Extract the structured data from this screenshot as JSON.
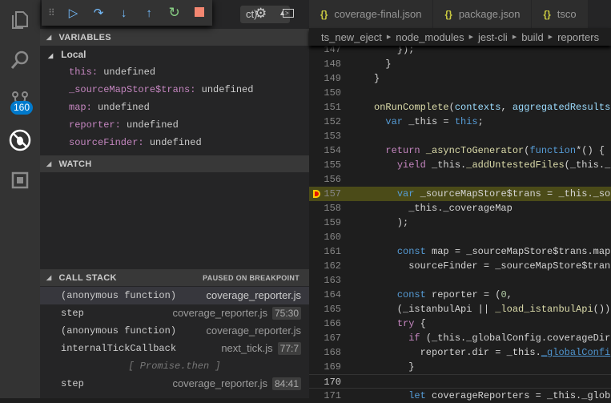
{
  "activity": {
    "scm_badge": "160"
  },
  "topbar": {
    "config_value": "ct)"
  },
  "variables": {
    "title": "VARIABLES",
    "scope": "Local",
    "items": [
      {
        "name": "this",
        "value": "undefined"
      },
      {
        "name": "_sourceMapStore$trans",
        "value": "undefined"
      },
      {
        "name": "map",
        "value": "undefined"
      },
      {
        "name": "reporter",
        "value": "undefined"
      },
      {
        "name": "sourceFinder",
        "value": "undefined"
      }
    ]
  },
  "watch": {
    "title": "WATCH"
  },
  "callstack": {
    "title": "CALL STACK",
    "status": "PAUSED ON BREAKPOINT",
    "frames": [
      {
        "fn": "(anonymous function)",
        "file": "coverage_reporter.js",
        "pos": ""
      },
      {
        "fn": "step",
        "file": "coverage_reporter.js",
        "pos": "75:30"
      },
      {
        "fn": "(anonymous function)",
        "file": "coverage_reporter.js",
        "pos": ""
      },
      {
        "fn": "internalTickCallback",
        "file": "next_tick.js",
        "pos": "77:7"
      },
      {
        "fn": "[ Promise.then ]",
        "file": "",
        "pos": ""
      },
      {
        "fn": "step",
        "file": "coverage_reporter.js",
        "pos": "84:41"
      }
    ]
  },
  "tabs": [
    {
      "label": "coverage-final.json"
    },
    {
      "label": "package.json"
    },
    {
      "label": "tsco"
    }
  ],
  "breadcrumbs": [
    "ts_new_eject",
    "node_modules",
    "jest-cli",
    "build",
    "reporters"
  ],
  "code": [
    {
      "n": "147",
      "s": [
        [
          "    });",
          ""
        ]
      ]
    },
    {
      "n": "148",
      "s": [
        [
          "  }",
          ""
        ]
      ]
    },
    {
      "n": "149",
      "s": [
        [
          "}",
          ""
        ]
      ]
    },
    {
      "n": "150",
      "s": []
    },
    {
      "n": "151",
      "s": [
        [
          "onRunComplete",
          "f"
        ],
        [
          "(",
          ""
        ],
        [
          "contexts",
          "p"
        ],
        [
          ", ",
          ""
        ],
        [
          "aggregatedResults",
          "p"
        ]
      ]
    },
    {
      "n": "152",
      "s": [
        [
          "  ",
          ""
        ],
        [
          "var",
          "k"
        ],
        [
          " _this = ",
          ""
        ],
        [
          "this",
          "k"
        ],
        [
          ";",
          ""
        ]
      ]
    },
    {
      "n": "153",
      "s": []
    },
    {
      "n": "154",
      "s": [
        [
          "  ",
          ""
        ],
        [
          "return",
          "c"
        ],
        [
          " ",
          ""
        ],
        [
          "_asyncToGenerator",
          "f"
        ],
        [
          "(",
          ""
        ],
        [
          "function",
          "k"
        ],
        [
          "*() {",
          ""
        ]
      ]
    },
    {
      "n": "155",
      "s": [
        [
          "    ",
          ""
        ],
        [
          "yield",
          "c"
        ],
        [
          " _this.",
          ""
        ],
        [
          "_addUntestedFiles",
          "f"
        ],
        [
          "(_this._",
          ""
        ]
      ]
    },
    {
      "n": "156",
      "s": []
    },
    {
      "n": "157",
      "s": [
        [
          "    ",
          ""
        ],
        [
          "var",
          "k"
        ],
        [
          " _sourceMapStore$trans = _this._so",
          ""
        ]
      ]
    },
    {
      "n": "158",
      "s": [
        [
          "      _this._coverageMap",
          ""
        ]
      ]
    },
    {
      "n": "159",
      "s": [
        [
          "    );",
          ""
        ]
      ]
    },
    {
      "n": "160",
      "s": []
    },
    {
      "n": "161",
      "s": [
        [
          "    ",
          ""
        ],
        [
          "const",
          "k"
        ],
        [
          " map = _sourceMapStore$trans.map",
          ""
        ]
      ]
    },
    {
      "n": "162",
      "s": [
        [
          "      sourceFinder = _sourceMapStore$tran",
          ""
        ]
      ]
    },
    {
      "n": "163",
      "s": []
    },
    {
      "n": "164",
      "s": [
        [
          "    ",
          ""
        ],
        [
          "const",
          "k"
        ],
        [
          " reporter = (",
          ""
        ],
        [
          "0",
          "n"
        ],
        [
          ",",
          ""
        ]
      ]
    },
    {
      "n": "165",
      "s": [
        [
          "    (_istanbulApi || ",
          ""
        ],
        [
          "_load_istanbulApi",
          "f"
        ],
        [
          "())",
          ""
        ]
      ]
    },
    {
      "n": "166",
      "s": [
        [
          "    ",
          ""
        ],
        [
          "try",
          "c"
        ],
        [
          " {",
          ""
        ]
      ]
    },
    {
      "n": "167",
      "s": [
        [
          "      ",
          ""
        ],
        [
          "if",
          "c"
        ],
        [
          " (_this._globalConfig.coverageDir",
          ""
        ]
      ]
    },
    {
      "n": "168",
      "s": [
        [
          "        reporter.dir = _this.",
          ""
        ],
        [
          "_globalConfi",
          "u"
        ]
      ]
    },
    {
      "n": "169",
      "s": [
        [
          "      }",
          ""
        ]
      ]
    },
    {
      "n": "170",
      "s": []
    },
    {
      "n": "171",
      "s": [
        [
          "      ",
          ""
        ],
        [
          "let",
          "k"
        ],
        [
          " coverageReporters = _this._glob",
          ""
        ]
      ]
    }
  ],
  "paused_line": "157",
  "cursor_line": "170"
}
